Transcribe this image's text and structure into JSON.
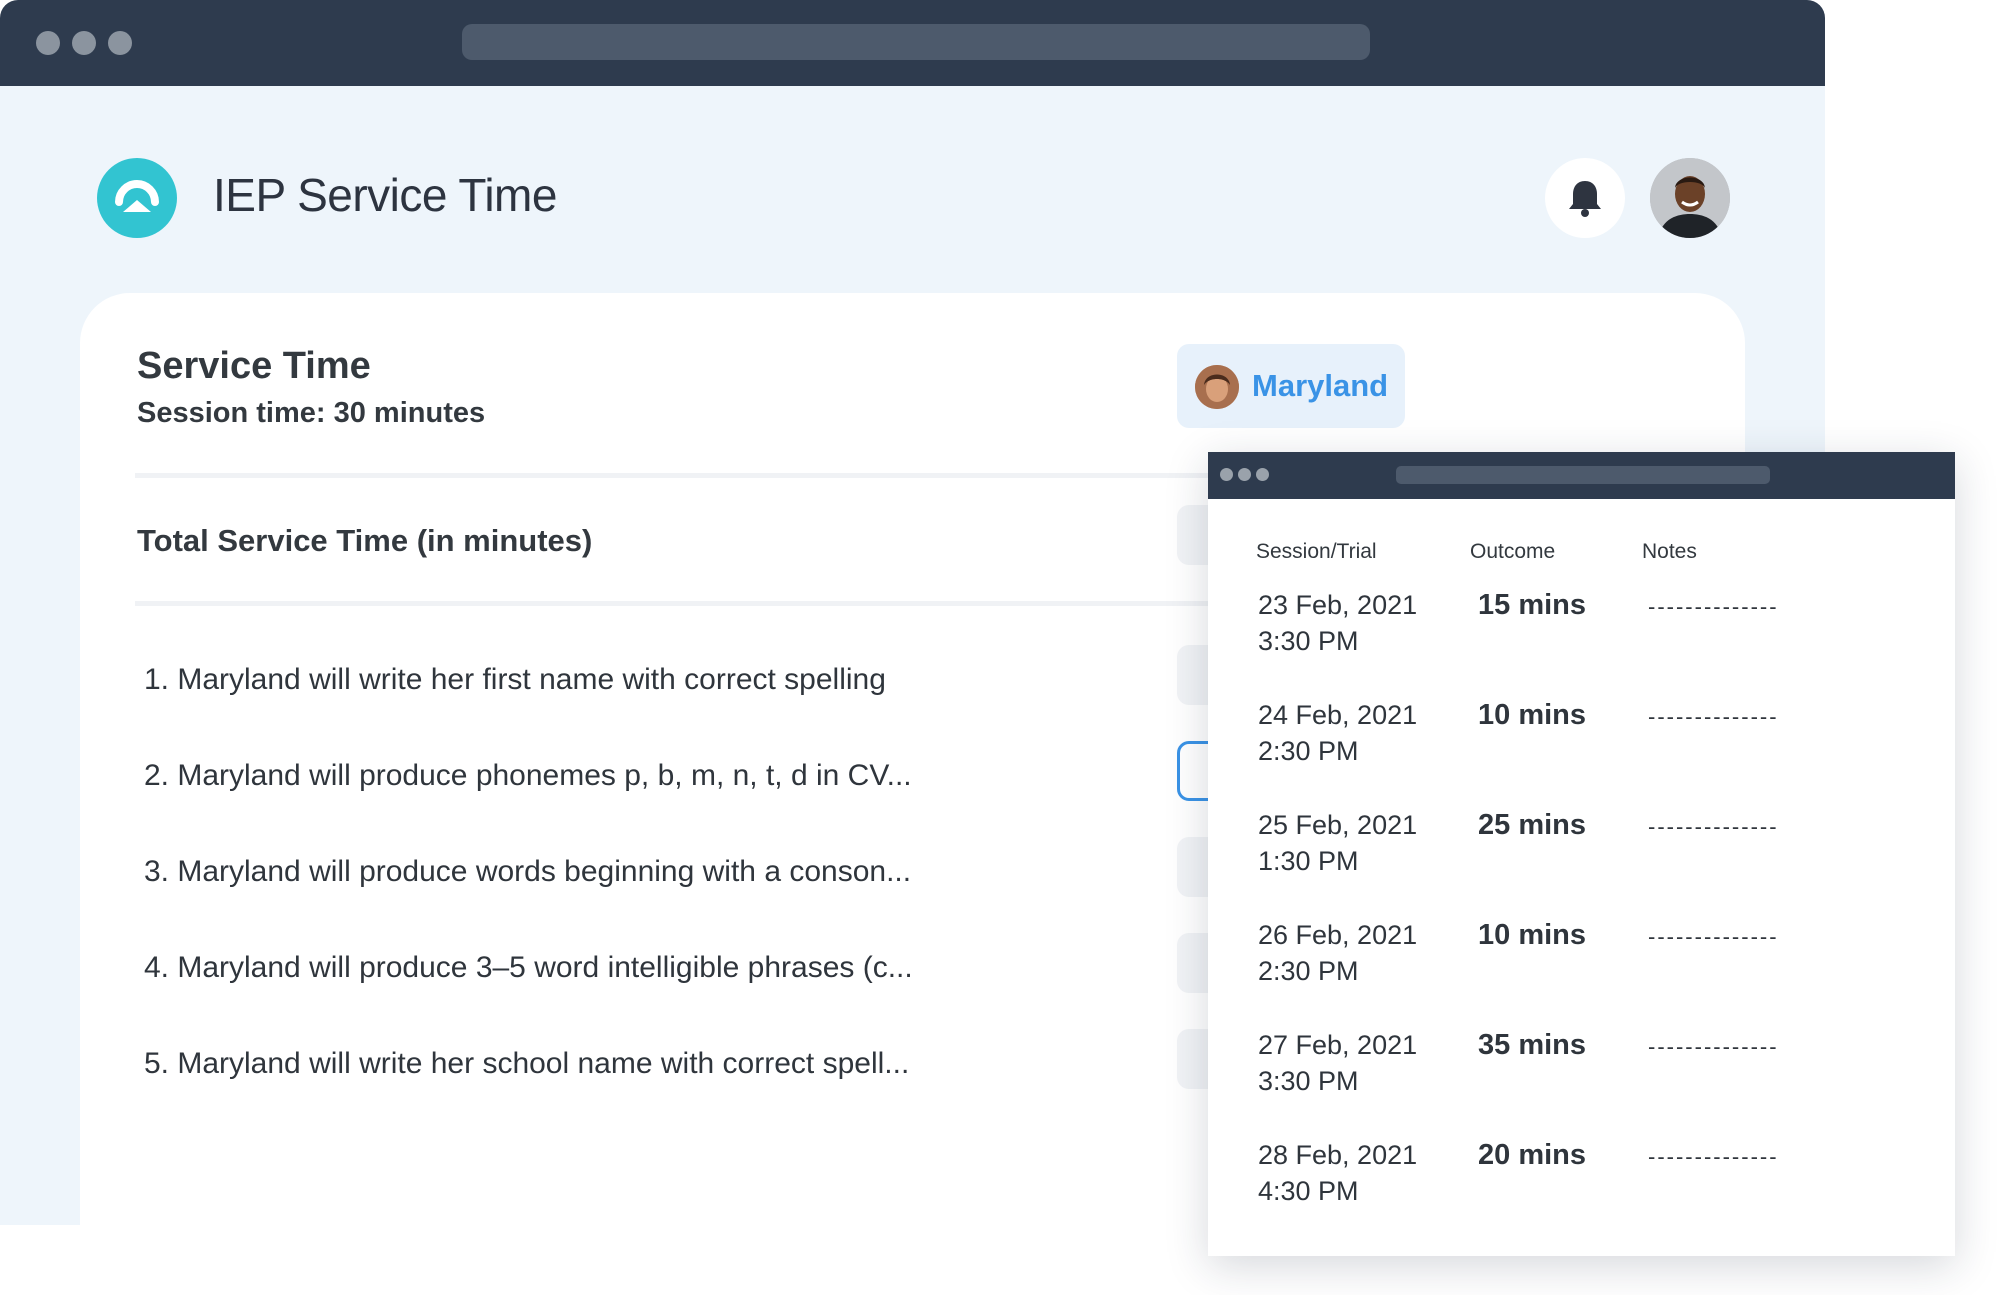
{
  "app": {
    "title": "IEP Service Time"
  },
  "card": {
    "title": "Service Time",
    "subtitle": "Session time: 30 minutes",
    "student_name": "Maryland",
    "total_label": "Total Service Time (in minutes)",
    "goals": [
      "1. Maryland will write her first name with correct spelling",
      "2. Maryland will produce phonemes p, b, m, n, t, d in CV...",
      "3. Maryland will produce words beginning with a conson...",
      "4. Maryland will produce 3–5 word intelligible phrases (c...",
      "5. Maryland will write her school name with correct spell..."
    ]
  },
  "popup": {
    "headers": {
      "session": "Session/Trial",
      "outcome": "Outcome",
      "notes": "Notes"
    },
    "rows": [
      {
        "date": "23 Feb, 2021",
        "time": "3:30 PM",
        "outcome": "15 mins",
        "notes": "--------------"
      },
      {
        "date": "24 Feb, 2021",
        "time": "2:30 PM",
        "outcome": "10 mins",
        "notes": "--------------"
      },
      {
        "date": "25 Feb, 2021",
        "time": "1:30 PM",
        "outcome": "25 mins",
        "notes": "--------------"
      },
      {
        "date": "26 Feb, 2021",
        "time": "2:30 PM",
        "outcome": "10 mins",
        "notes": "--------------"
      },
      {
        "date": "27 Feb, 2021",
        "time": "3:30 PM",
        "outcome": "35 mins",
        "notes": "--------------"
      },
      {
        "date": "28 Feb, 2021",
        "time": "4:30 PM",
        "outcome": "20 mins",
        "notes": "--------------"
      }
    ]
  },
  "icons": {
    "logo": "app-logo-icon",
    "notifications": "bell-icon",
    "profile": "user-avatar"
  },
  "colors": {
    "accent": "#3a93e6",
    "brand": "#32c4d1",
    "titlebar": "#2e3b4e"
  }
}
